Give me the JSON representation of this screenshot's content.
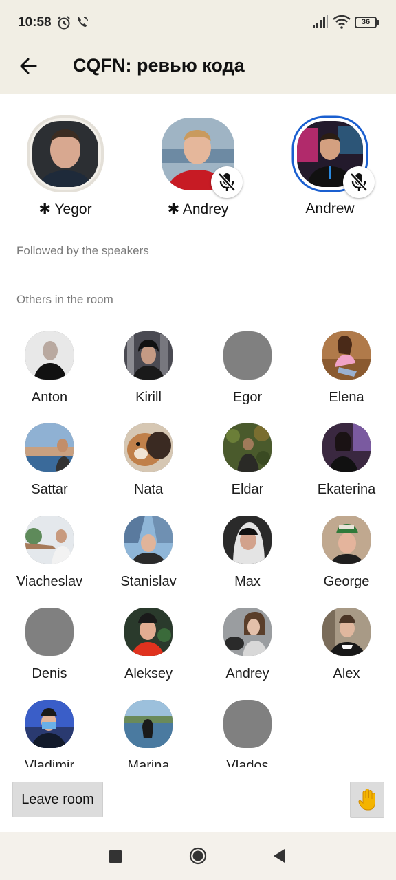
{
  "status_bar": {
    "time": "10:58",
    "battery": "36",
    "icons": [
      "alarm-icon",
      "call-icon",
      "signal-icon",
      "wifi-icon",
      "battery-icon"
    ]
  },
  "header": {
    "title": "CQFN: ревью кода",
    "back_icon": "arrow-left-icon"
  },
  "speakers": [
    {
      "name": "✱ Yegor",
      "muted": false,
      "speaking": true,
      "avatar": "photo"
    },
    {
      "name": "✱ Andrey",
      "muted": true,
      "speaking": false,
      "avatar": "photo"
    },
    {
      "name": "Andrew",
      "muted": true,
      "speaking": false,
      "avatar": "photo",
      "ring_color": "#1a5fd0"
    }
  ],
  "sections": {
    "followed": "Followed by the speakers",
    "others": "Others in the room"
  },
  "audience": [
    {
      "name": "Anton"
    },
    {
      "name": "Kirill"
    },
    {
      "name": "Egor",
      "placeholder": true
    },
    {
      "name": "Elena"
    },
    {
      "name": "Sattar"
    },
    {
      "name": "Nata"
    },
    {
      "name": "Eldar"
    },
    {
      "name": "Ekaterina"
    },
    {
      "name": "Viacheslav"
    },
    {
      "name": "Stanislav"
    },
    {
      "name": "Max"
    },
    {
      "name": "George"
    },
    {
      "name": "Denis",
      "placeholder": true
    },
    {
      "name": "Aleksey"
    },
    {
      "name": "Andrey"
    },
    {
      "name": "Alex"
    },
    {
      "name": "Vladimir"
    },
    {
      "name": "Marina"
    },
    {
      "name": "Vlados",
      "placeholder": true
    }
  ],
  "footer": {
    "leave_label": "Leave room",
    "hand_icon": "raised-hand-icon"
  },
  "nav": [
    "recents-square-icon",
    "home-circle-icon",
    "back-triangle-icon"
  ],
  "colors": {
    "header_bg": "#f1eee4",
    "placeholder_avatar": "#808080",
    "button_bg": "#dcdcdc",
    "muted_text": "#7b7b7b"
  }
}
